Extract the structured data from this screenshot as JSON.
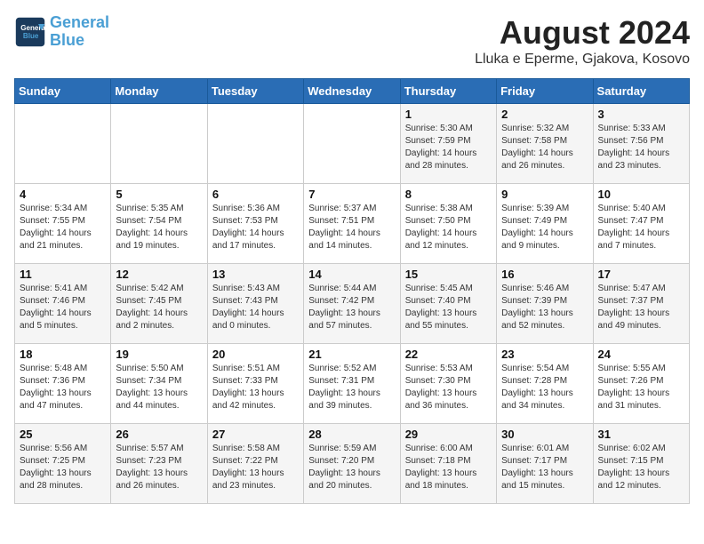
{
  "header": {
    "logo_line1": "General",
    "logo_line2": "Blue",
    "title": "August 2024",
    "subtitle": "Lluka e Eperme, Gjakova, Kosovo"
  },
  "weekdays": [
    "Sunday",
    "Monday",
    "Tuesday",
    "Wednesday",
    "Thursday",
    "Friday",
    "Saturday"
  ],
  "weeks": [
    [
      {
        "day": "",
        "info": ""
      },
      {
        "day": "",
        "info": ""
      },
      {
        "day": "",
        "info": ""
      },
      {
        "day": "",
        "info": ""
      },
      {
        "day": "1",
        "info": "Sunrise: 5:30 AM\nSunset: 7:59 PM\nDaylight: 14 hours\nand 28 minutes."
      },
      {
        "day": "2",
        "info": "Sunrise: 5:32 AM\nSunset: 7:58 PM\nDaylight: 14 hours\nand 26 minutes."
      },
      {
        "day": "3",
        "info": "Sunrise: 5:33 AM\nSunset: 7:56 PM\nDaylight: 14 hours\nand 23 minutes."
      }
    ],
    [
      {
        "day": "4",
        "info": "Sunrise: 5:34 AM\nSunset: 7:55 PM\nDaylight: 14 hours\nand 21 minutes."
      },
      {
        "day": "5",
        "info": "Sunrise: 5:35 AM\nSunset: 7:54 PM\nDaylight: 14 hours\nand 19 minutes."
      },
      {
        "day": "6",
        "info": "Sunrise: 5:36 AM\nSunset: 7:53 PM\nDaylight: 14 hours\nand 17 minutes."
      },
      {
        "day": "7",
        "info": "Sunrise: 5:37 AM\nSunset: 7:51 PM\nDaylight: 14 hours\nand 14 minutes."
      },
      {
        "day": "8",
        "info": "Sunrise: 5:38 AM\nSunset: 7:50 PM\nDaylight: 14 hours\nand 12 minutes."
      },
      {
        "day": "9",
        "info": "Sunrise: 5:39 AM\nSunset: 7:49 PM\nDaylight: 14 hours\nand 9 minutes."
      },
      {
        "day": "10",
        "info": "Sunrise: 5:40 AM\nSunset: 7:47 PM\nDaylight: 14 hours\nand 7 minutes."
      }
    ],
    [
      {
        "day": "11",
        "info": "Sunrise: 5:41 AM\nSunset: 7:46 PM\nDaylight: 14 hours\nand 5 minutes."
      },
      {
        "day": "12",
        "info": "Sunrise: 5:42 AM\nSunset: 7:45 PM\nDaylight: 14 hours\nand 2 minutes."
      },
      {
        "day": "13",
        "info": "Sunrise: 5:43 AM\nSunset: 7:43 PM\nDaylight: 14 hours\nand 0 minutes."
      },
      {
        "day": "14",
        "info": "Sunrise: 5:44 AM\nSunset: 7:42 PM\nDaylight: 13 hours\nand 57 minutes."
      },
      {
        "day": "15",
        "info": "Sunrise: 5:45 AM\nSunset: 7:40 PM\nDaylight: 13 hours\nand 55 minutes."
      },
      {
        "day": "16",
        "info": "Sunrise: 5:46 AM\nSunset: 7:39 PM\nDaylight: 13 hours\nand 52 minutes."
      },
      {
        "day": "17",
        "info": "Sunrise: 5:47 AM\nSunset: 7:37 PM\nDaylight: 13 hours\nand 49 minutes."
      }
    ],
    [
      {
        "day": "18",
        "info": "Sunrise: 5:48 AM\nSunset: 7:36 PM\nDaylight: 13 hours\nand 47 minutes."
      },
      {
        "day": "19",
        "info": "Sunrise: 5:50 AM\nSunset: 7:34 PM\nDaylight: 13 hours\nand 44 minutes."
      },
      {
        "day": "20",
        "info": "Sunrise: 5:51 AM\nSunset: 7:33 PM\nDaylight: 13 hours\nand 42 minutes."
      },
      {
        "day": "21",
        "info": "Sunrise: 5:52 AM\nSunset: 7:31 PM\nDaylight: 13 hours\nand 39 minutes."
      },
      {
        "day": "22",
        "info": "Sunrise: 5:53 AM\nSunset: 7:30 PM\nDaylight: 13 hours\nand 36 minutes."
      },
      {
        "day": "23",
        "info": "Sunrise: 5:54 AM\nSunset: 7:28 PM\nDaylight: 13 hours\nand 34 minutes."
      },
      {
        "day": "24",
        "info": "Sunrise: 5:55 AM\nSunset: 7:26 PM\nDaylight: 13 hours\nand 31 minutes."
      }
    ],
    [
      {
        "day": "25",
        "info": "Sunrise: 5:56 AM\nSunset: 7:25 PM\nDaylight: 13 hours\nand 28 minutes."
      },
      {
        "day": "26",
        "info": "Sunrise: 5:57 AM\nSunset: 7:23 PM\nDaylight: 13 hours\nand 26 minutes."
      },
      {
        "day": "27",
        "info": "Sunrise: 5:58 AM\nSunset: 7:22 PM\nDaylight: 13 hours\nand 23 minutes."
      },
      {
        "day": "28",
        "info": "Sunrise: 5:59 AM\nSunset: 7:20 PM\nDaylight: 13 hours\nand 20 minutes."
      },
      {
        "day": "29",
        "info": "Sunrise: 6:00 AM\nSunset: 7:18 PM\nDaylight: 13 hours\nand 18 minutes."
      },
      {
        "day": "30",
        "info": "Sunrise: 6:01 AM\nSunset: 7:17 PM\nDaylight: 13 hours\nand 15 minutes."
      },
      {
        "day": "31",
        "info": "Sunrise: 6:02 AM\nSunset: 7:15 PM\nDaylight: 13 hours\nand 12 minutes."
      }
    ]
  ]
}
